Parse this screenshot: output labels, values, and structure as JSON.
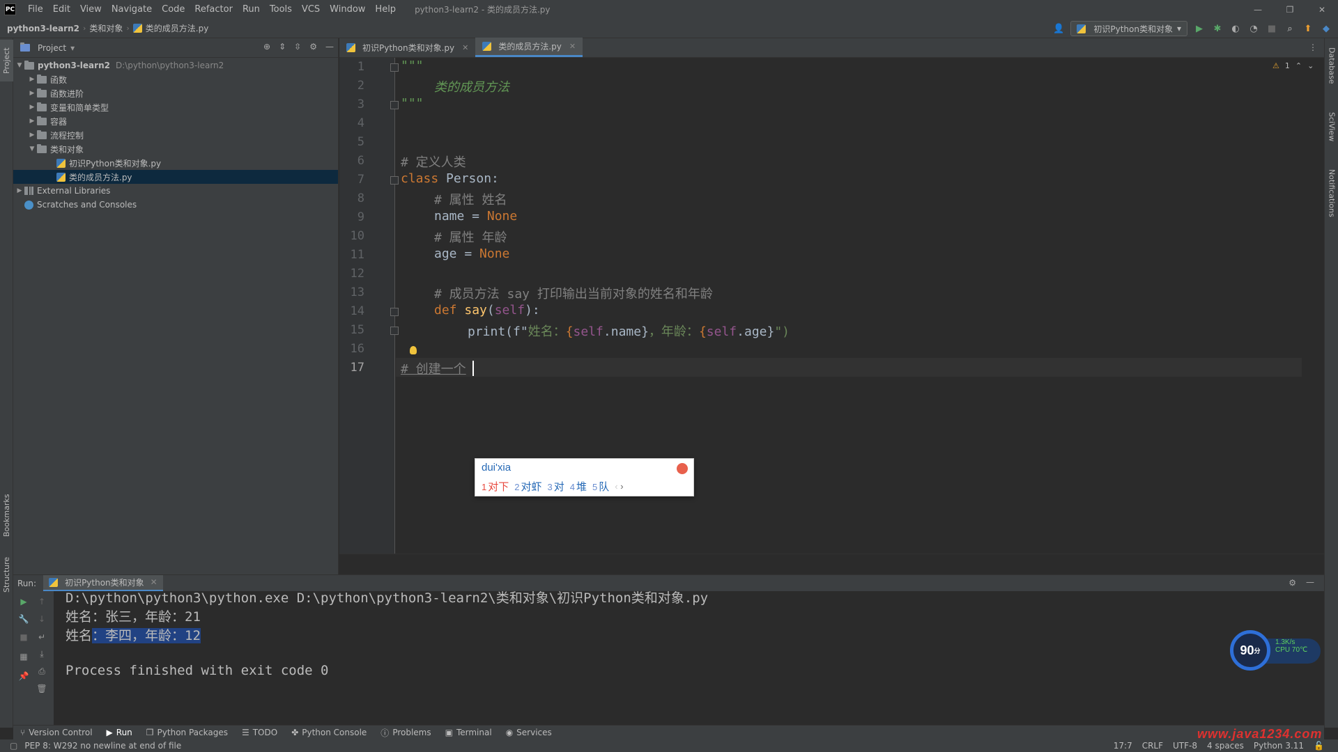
{
  "window": {
    "app_logo": "PC",
    "title": "python3-learn2 - 类的成员方法.py",
    "menu": [
      "File",
      "Edit",
      "View",
      "Navigate",
      "Code",
      "Refactor",
      "Run",
      "Tools",
      "VCS",
      "Window",
      "Help"
    ]
  },
  "navbar": {
    "breadcrumbs": [
      "python3-learn2",
      "类和对象",
      "类的成员方法.py"
    ],
    "run_config": "初识Python类和对象"
  },
  "project": {
    "title": "Project",
    "tree": [
      {
        "label": "python3-learn2",
        "path": "D:\\python\\python3-learn2",
        "type": "root",
        "expanded": true
      },
      {
        "label": "函数",
        "type": "folder"
      },
      {
        "label": "函数进阶",
        "type": "folder"
      },
      {
        "label": "变量和简单类型",
        "type": "folder"
      },
      {
        "label": "容器",
        "type": "folder"
      },
      {
        "label": "流程控制",
        "type": "folder"
      },
      {
        "label": "类和对象",
        "type": "folder",
        "expanded": true
      },
      {
        "label": "初识Python类和对象.py",
        "type": "file"
      },
      {
        "label": "类的成员方法.py",
        "type": "file",
        "selected": true
      },
      {
        "label": "External Libraries",
        "type": "lib"
      },
      {
        "label": "Scratches and Consoles",
        "type": "scratch"
      }
    ]
  },
  "editor": {
    "tabs": [
      {
        "label": "初识Python类和对象.py",
        "active": false
      },
      {
        "label": "类的成员方法.py",
        "active": true
      }
    ],
    "line_numbers": [
      "1",
      "2",
      "3",
      "4",
      "5",
      "6",
      "7",
      "8",
      "9",
      "10",
      "11",
      "12",
      "13",
      "14",
      "15",
      "16",
      "17"
    ],
    "current_line": 17,
    "warnings": "1",
    "lines": {
      "l1": "\"\"\"",
      "l2": "类的成员方法",
      "l3": "\"\"\"",
      "l6": "# 定义人类",
      "l7_kw": "class",
      "l7_rest": " Person:",
      "l8": "# 属性 姓名",
      "l9_a": "name = ",
      "l9_b": "None",
      "l10": "# 属性 年龄",
      "l11_a": "age = ",
      "l11_b": "None",
      "l13": "# 成员方法 say 打印输出当前对象的姓名和年龄",
      "l14_kw": "def",
      "l14_fn": "say",
      "l14_p1": "(",
      "l14_self": "self",
      "l14_p2": "):",
      "l15_a": "print(f\"",
      "l15_b": "姓名：",
      "l15_c": "{",
      "l15_d": "self",
      "l15_e": ".name}",
      "l15_f": "，年龄：",
      "l15_g": "{",
      "l15_h": "self",
      "l15_i": ".age}",
      "l15_j": "\")",
      "l17": "# 创建一个"
    }
  },
  "ime": {
    "pinyin": "dui'xia",
    "candidates": [
      {
        "num": "1",
        "text": "对下"
      },
      {
        "num": "2",
        "text": "对虾"
      },
      {
        "num": "3",
        "text": "对"
      },
      {
        "num": "4",
        "text": "堆"
      },
      {
        "num": "5",
        "text": "队"
      }
    ],
    "prev": "‹",
    "next": "›"
  },
  "run": {
    "label": "Run:",
    "tab": "初识Python类和对象",
    "output": {
      "cmd": "D:\\python\\python3\\python.exe D:\\python\\python3-learn2\\类和对象\\初识Python类和对象.py",
      "line1": "姓名：张三，年龄：21",
      "line2_a": "姓名",
      "line2_b": "：李四，年龄：12",
      "finish": "Process finished with exit code 0"
    }
  },
  "perf": {
    "score": "90",
    "unit": "分",
    "net": "1.3K/s",
    "cpu": "CPU 70℃"
  },
  "toolwindows": [
    "Version Control",
    "Run",
    "Python Packages",
    "TODO",
    "Python Console",
    "Problems",
    "Terminal",
    "Services"
  ],
  "left_strip": [
    "Project",
    "Bookmarks",
    "Structure"
  ],
  "right_strip": [
    "Database",
    "SciView",
    "Notifications"
  ],
  "status": {
    "message": "PEP 8: W292 no newline at end of file",
    "position": "17:7",
    "line_sep": "CRLF",
    "encoding": "UTF-8",
    "indent": "4 spaces",
    "interpreter": "Python 3.11"
  },
  "watermark": "www.java1234.com",
  "colors": {
    "accent": "#4a88c7",
    "keyword": "#cc7832",
    "comment": "#808080",
    "docstring": "#629755",
    "function": "#ffc66d",
    "self": "#94558d",
    "string": "#6a8759"
  }
}
